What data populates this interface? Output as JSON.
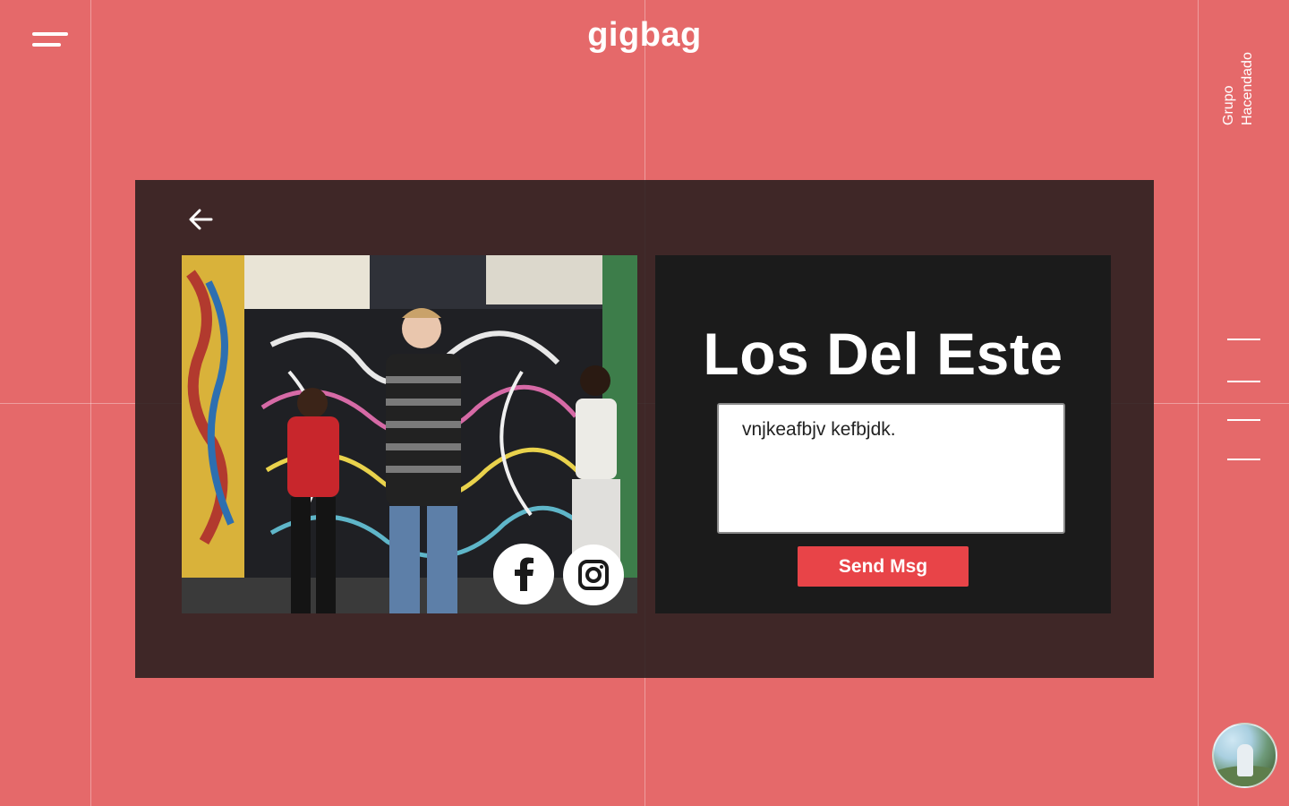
{
  "header": {
    "logo_text": "gigbag",
    "company_line1": "Grupo",
    "company_line2": "Hacendado"
  },
  "colors": {
    "background": "#e5696a",
    "panel": "#281e1e",
    "card": "#1b1b1b",
    "accent_button": "#e84448"
  },
  "band": {
    "name": "Los Del Este",
    "photo_icon": "band-photo",
    "social": [
      {
        "name": "facebook",
        "icon": "facebook-icon"
      },
      {
        "name": "instagram",
        "icon": "instagram-icon"
      }
    ]
  },
  "message": {
    "value": "vnjkeafbjv kefbjdk.",
    "send_label": "Send Msg"
  },
  "side_nav": {
    "items": 4
  },
  "icons": {
    "menu": "menu-icon",
    "back": "arrow-left-icon",
    "avatar": "user-avatar"
  }
}
